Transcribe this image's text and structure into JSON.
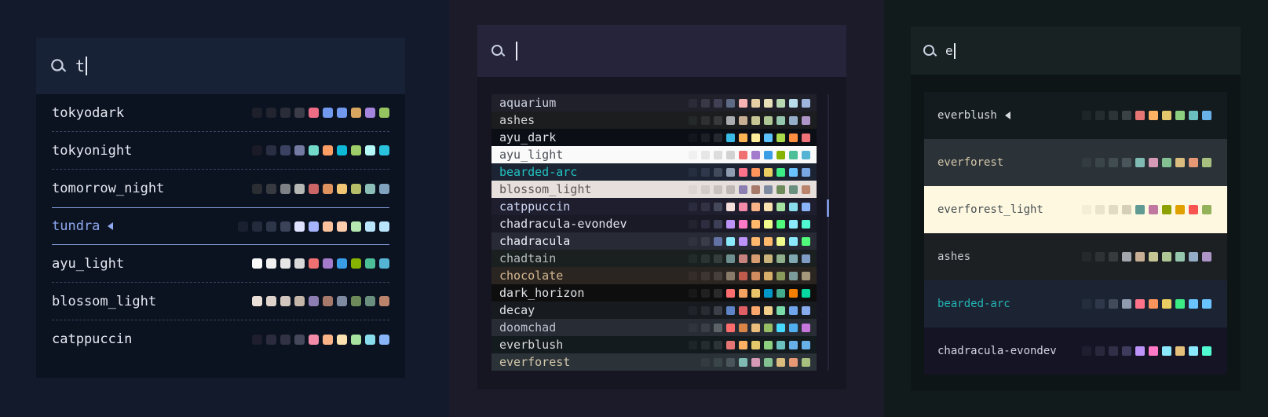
{
  "panel1": {
    "query": "t",
    "items": [
      {
        "name": "tokyodark",
        "current": false,
        "text": "#e6e9f2",
        "swatches": [
          "#1d1f2b",
          "#22242f",
          "#2a2c38",
          "#3a3c48",
          "#ee6d85",
          "#7199ee",
          "#7199ee",
          "#d7a65f",
          "#a485dd",
          "#95c561"
        ]
      },
      {
        "name": "tokyonight",
        "current": false,
        "text": "#e6e9f2",
        "swatches": [
          "#1a1b26",
          "#292e42",
          "#3b4261",
          "#737aa2",
          "#73daca",
          "#ff9e64",
          "#0db9d7",
          "#9ece6a",
          "#b4f9f8",
          "#2ac3de"
        ]
      },
      {
        "name": "tomorrow_night",
        "current": false,
        "text": "#e6e9f2",
        "swatches": [
          "#2a2d31",
          "#373b41",
          "#7f8284",
          "#b4b7b4",
          "#cc6666",
          "#de935f",
          "#f0c674",
          "#b5bd68",
          "#8abeb7",
          "#81a2be"
        ]
      },
      {
        "name": "tundra",
        "current": true,
        "text": "#8fa8f0",
        "swatches": [
          "#1a2030",
          "#242b3d",
          "#2d3548",
          "#3a4358",
          "#e0e3ff",
          "#a5b4fc",
          "#fbc19d",
          "#fecdab",
          "#b5e8b0",
          "#bae6fd",
          "#bae6fd"
        ]
      },
      {
        "name": "ayu_light",
        "current": false,
        "text": "#e6e9f2",
        "swatches": [
          "#fafafa",
          "#f0f0f0",
          "#e6e6e6",
          "#d9d9d9",
          "#f07171",
          "#a37acc",
          "#399ee6",
          "#86b300",
          "#4cbf99",
          "#55b4d4"
        ]
      },
      {
        "name": "blossom_light",
        "current": false,
        "text": "#e6e9f2",
        "swatches": [
          "#eae0d7",
          "#ddd3ca",
          "#d0c6bd",
          "#c4b7aa",
          "#8c7eb0",
          "#a7796a",
          "#7d8aa0",
          "#6d8a5b",
          "#6b8f7f",
          "#b9836c"
        ]
      },
      {
        "name": "catppuccin",
        "current": false,
        "text": "#e6e9f2",
        "swatches": [
          "#1e1e2e",
          "#2a2b3c",
          "#313244",
          "#45475a",
          "#f38ba8",
          "#fab387",
          "#f9e2af",
          "#a6e3a1",
          "#89dceb",
          "#89b4fa"
        ]
      }
    ]
  },
  "panel2": {
    "query": "",
    "items": [
      {
        "name": "aquarium",
        "bg": "#20202b",
        "text": "#cdd3e0",
        "swatches": [
          "#2b2b38",
          "#383847",
          "#414155",
          "#5e6a85",
          "#f6b3b3",
          "#e6cfa5",
          "#e6dfb8",
          "#b7d8b0",
          "#b8dceb",
          "#a0b5de"
        ]
      },
      {
        "name": "ashes",
        "bg": "#1b1d1e",
        "text": "#d0d2d4",
        "swatches": [
          "#252829",
          "#2e3132",
          "#373a3b",
          "#a9adb0",
          "#c7ae95",
          "#c7c795",
          "#aec795",
          "#95c7ae",
          "#95aec7",
          "#ae95c7"
        ]
      },
      {
        "name": "ayu_dark",
        "bg": "#0b0e14",
        "text": "#dfe2e8",
        "swatches": [
          "#13161c",
          "#1c1f25",
          "#252830",
          "#39bae6",
          "#ffb454",
          "#ffee99",
          "#59c2ff",
          "#aad94c",
          "#ff8f40",
          "#f07178"
        ]
      },
      {
        "name": "ayu_light",
        "bg": "#fafafa",
        "text": "#4a4f57",
        "swatches": [
          "#f0f0f0",
          "#e6e6e6",
          "#dcdcdc",
          "#d2d2d2",
          "#f07171",
          "#a37acc",
          "#399ee6",
          "#86b300",
          "#4cbf99",
          "#55b4d4"
        ]
      },
      {
        "name": "bearded-arc",
        "bg": "#1c2433",
        "text": "#22c2c2",
        "swatches": [
          "#242e3f",
          "#2e384a",
          "#414b5c",
          "#8f9cb0",
          "#ff738a",
          "#ff955c",
          "#eacd61",
          "#3cec85",
          "#69c3ff",
          "#78a7e4"
        ]
      },
      {
        "name": "blossom_light",
        "bg": "#e6dfdc",
        "text": "#5e5555",
        "swatches": [
          "#ddd5d1",
          "#d3cbc7",
          "#c9c1bd",
          "#bfb7b3",
          "#8c7eb0",
          "#a7796a",
          "#7d8aa0",
          "#6d8a5b",
          "#6b8f7f",
          "#b9836c"
        ]
      },
      {
        "name": "catppuccin",
        "bg": "#1e1e2e",
        "text": "#cdd6f4",
        "swatches": [
          "#2a2b3c",
          "#313244",
          "#45475a",
          "#f5e0dc",
          "#f38ba8",
          "#fab387",
          "#f9e2af",
          "#a6e3a1",
          "#89dceb",
          "#89b4fa"
        ]
      },
      {
        "name": "chadracula-evondev",
        "bg": "#191a26",
        "text": "#e4e4ef",
        "swatches": [
          "#22232f",
          "#2c2d3e",
          "#3d3f56",
          "#bd93f9",
          "#ff79c6",
          "#ffb86c",
          "#f1fa8c",
          "#50fa7b",
          "#8be9fd",
          "#50fad2"
        ]
      },
      {
        "name": "chadracula",
        "bg": "#282a36",
        "text": "#eeeff6",
        "swatches": [
          "#30323e",
          "#3a3c4a",
          "#6272a4",
          "#8be9fd",
          "#bd93f9",
          "#ffb86c",
          "#ffb86c",
          "#f1fa8c",
          "#8be9fd",
          "#50fa7b"
        ]
      },
      {
        "name": "chadtain",
        "bg": "#1a2020",
        "text": "#b6bdc0",
        "swatches": [
          "#232a2a",
          "#2b3333",
          "#343c3c",
          "#6e8f8f",
          "#c5827f",
          "#d79c6f",
          "#c9b37a",
          "#8fae8a",
          "#7fa8b0",
          "#7f9cc5"
        ]
      },
      {
        "name": "chocolate",
        "bg": "#2b2522",
        "text": "#d6b991",
        "swatches": [
          "#342d2a",
          "#3d3532",
          "#473f3b",
          "#8a7a6a",
          "#c05b4e",
          "#d08b5e",
          "#d8b06a",
          "#8a9a5b",
          "#7b9c9a",
          "#a6997b"
        ]
      },
      {
        "name": "dark_horizon",
        "bg": "#0e0e0e",
        "text": "#e0e2e5",
        "swatches": [
          "#181818",
          "#202020",
          "#2a2a2a",
          "#ff6e6e",
          "#f4a261",
          "#e9c46a",
          "#0096c7",
          "#43aa8b",
          "#f77f00",
          "#06d6a0"
        ]
      },
      {
        "name": "decay",
        "bg": "#171b20",
        "text": "#dee1e6",
        "swatches": [
          "#20242a",
          "#282c32",
          "#3b4048",
          "#5e83c6",
          "#e05f65",
          "#f9a76c",
          "#f1cf8a",
          "#78dba9",
          "#70a5eb",
          "#86aaec"
        ]
      },
      {
        "name": "doomchad",
        "bg": "#282c34",
        "text": "#bbc2cf",
        "swatches": [
          "#30343c",
          "#3a3e46",
          "#5b6268",
          "#ff6c6b",
          "#da8548",
          "#ecbe7b",
          "#98be65",
          "#46d9ff",
          "#51afef",
          "#c678dd"
        ]
      },
      {
        "name": "everblush",
        "bg": "#141b1e",
        "text": "#dadada",
        "swatches": [
          "#1e2528",
          "#252c2f",
          "#2d3437",
          "#e57474",
          "#fcb163",
          "#e5c76b",
          "#8ccf7e",
          "#6cbfbf",
          "#67b0e8",
          "#67b0e8"
        ]
      },
      {
        "name": "everforest",
        "bg": "#2b3339",
        "text": "#d3c6aa",
        "swatches": [
          "#323c41",
          "#3a454a",
          "#4a555b",
          "#7fbbb3",
          "#d699b6",
          "#83c092",
          "#dbbc7f",
          "#e69875",
          "#a7c080"
        ]
      }
    ]
  },
  "panel3": {
    "query": "e",
    "items": [
      {
        "name": "everblush",
        "current": true,
        "bg": "#141b1e",
        "text": "#d7dadc",
        "swatches": [
          "#1e2528",
          "#252c2f",
          "#2d3437",
          "#3b4245",
          "#e57474",
          "#fcb163",
          "#e5c76b",
          "#8ccf7e",
          "#6cbfbf",
          "#67b0e8"
        ]
      },
      {
        "name": "everforest",
        "current": false,
        "bg": "#2b3339",
        "text": "#d3c6aa",
        "swatches": [
          "#323c41",
          "#3a454a",
          "#424d52",
          "#4a555b",
          "#7fbbb3",
          "#d699b6",
          "#83c092",
          "#dbbc7f",
          "#e69875",
          "#a7c080"
        ]
      },
      {
        "name": "everforest_light",
        "current": false,
        "bg": "#fff8e1",
        "text": "#454e52",
        "swatches": [
          "#f3eed5",
          "#ebe4cc",
          "#e2dbc4",
          "#d6cfb8",
          "#5f9b93",
          "#c078a0",
          "#8da101",
          "#dfa000",
          "#f85552",
          "#93b259"
        ]
      },
      {
        "name": "ashes",
        "current": false,
        "bg": "#1c2023",
        "text": "#c7ccd1",
        "swatches": [
          "#25292c",
          "#2e3235",
          "#373b3e",
          "#a1a7ac",
          "#c7ae95",
          "#c7c795",
          "#aec795",
          "#95c7ae",
          "#95aec7",
          "#ae95c7"
        ]
      },
      {
        "name": "bearded-arc",
        "current": false,
        "bg": "#1c2433",
        "text": "#22b5b5",
        "swatches": [
          "#242e3f",
          "#2e384a",
          "#414b5c",
          "#8f9cb0",
          "#ff738a",
          "#ff955c",
          "#eacd61",
          "#3cec85",
          "#69c3ff",
          "#69c3ff"
        ]
      },
      {
        "name": "chadracula-evondev",
        "current": false,
        "bg": "#151424",
        "text": "#d4d4e4",
        "swatches": [
          "#1f1e30",
          "#28273c",
          "#302f48",
          "#3d3c5c",
          "#bd93f9",
          "#ff79c6",
          "#8be9fd",
          "#e5c07b",
          "#8be9fd",
          "#50fad2"
        ]
      }
    ]
  }
}
